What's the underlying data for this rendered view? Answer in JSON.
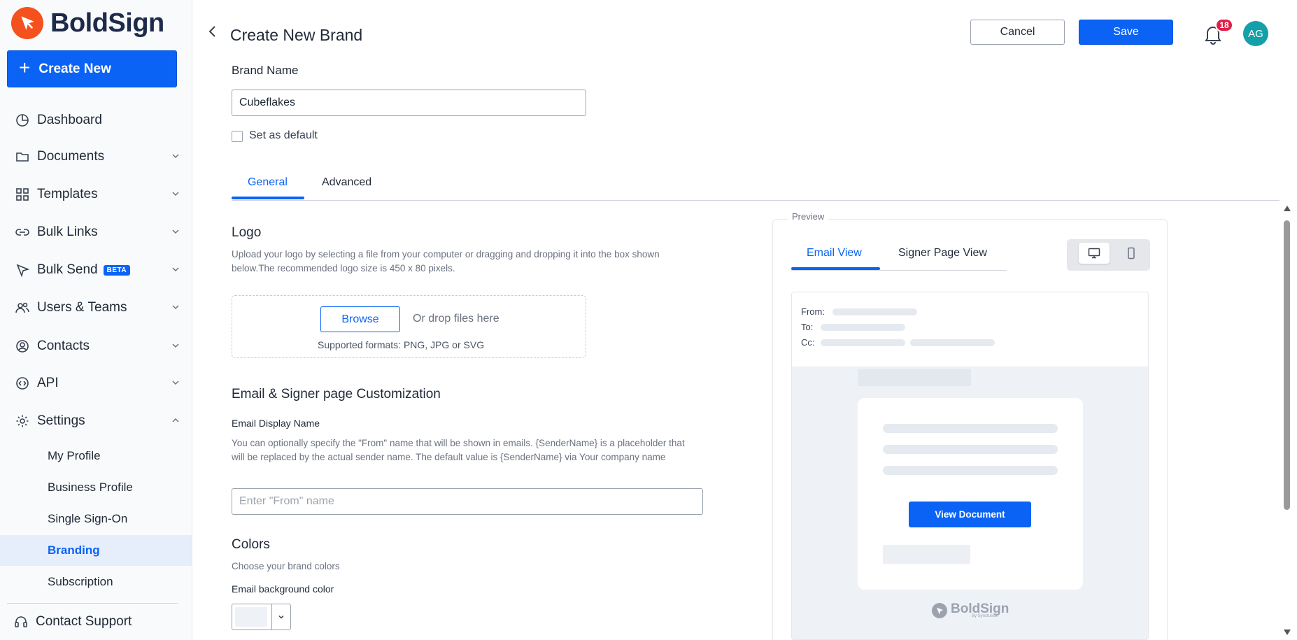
{
  "app": {
    "name": "BoldSign",
    "brand_color": "#f4511e",
    "accent": "#0b63f6"
  },
  "sidebar": {
    "create_new": "Create New",
    "items": [
      {
        "label": "Dashboard",
        "icon": "pie-chart-icon"
      },
      {
        "label": "Documents",
        "icon": "folder-icon"
      },
      {
        "label": "Templates",
        "icon": "grid-icon"
      },
      {
        "label": "Bulk Links",
        "icon": "link-icon"
      },
      {
        "label": "Bulk Send",
        "icon": "send-icon",
        "badge": "BETA"
      },
      {
        "label": "Users & Teams",
        "icon": "users-icon"
      },
      {
        "label": "Contacts",
        "icon": "contact-icon"
      },
      {
        "label": "API",
        "icon": "code-icon"
      },
      {
        "label": "Settings",
        "icon": "gear-icon"
      }
    ],
    "settings_sub": [
      {
        "label": "My Profile"
      },
      {
        "label": "Business Profile"
      },
      {
        "label": "Single Sign-On"
      },
      {
        "label": "Branding",
        "active": true
      },
      {
        "label": "Subscription"
      }
    ],
    "contact_support": "Contact Support"
  },
  "header": {
    "title": "Create New Brand",
    "cancel": "Cancel",
    "save": "Save",
    "notifications": "18",
    "avatar": "AG"
  },
  "form": {
    "brand_name_label": "Brand Name",
    "brand_name_value": "Cubeflakes",
    "set_default": "Set as default",
    "tabs": [
      "General",
      "Advanced"
    ],
    "logo_title": "Logo",
    "logo_help": "Upload your logo by selecting a file from your computer or dragging and dropping it into the box shown below.The recommended logo size is 450 x 80 pixels.",
    "browse": "Browse",
    "drop_text": "Or drop files here",
    "formats": "Supported formats: PNG, JPG or SVG",
    "custom_title": "Email & Signer page Customization",
    "display_name_label": "Email Display Name",
    "display_name_help": "You can optionally specify the \"From\" name that will be shown in emails. {SenderName} is a placeholder that will be replaced by the actual sender name. The default value is {SenderName} via Your company name",
    "from_placeholder": "Enter \"From\" name",
    "colors_title": "Colors",
    "colors_help": "Choose your brand colors",
    "email_bg_label": "Email background color",
    "email_bg_color": "#eef1f6"
  },
  "preview": {
    "legend": "Preview",
    "tabs": [
      "Email View",
      "Signer Page View"
    ],
    "from": "From:",
    "to": "To:",
    "cc": "Cc:",
    "view_document": "View Document",
    "footer_logo": "BoldSign",
    "footer_sub": "By Syncfusion"
  }
}
